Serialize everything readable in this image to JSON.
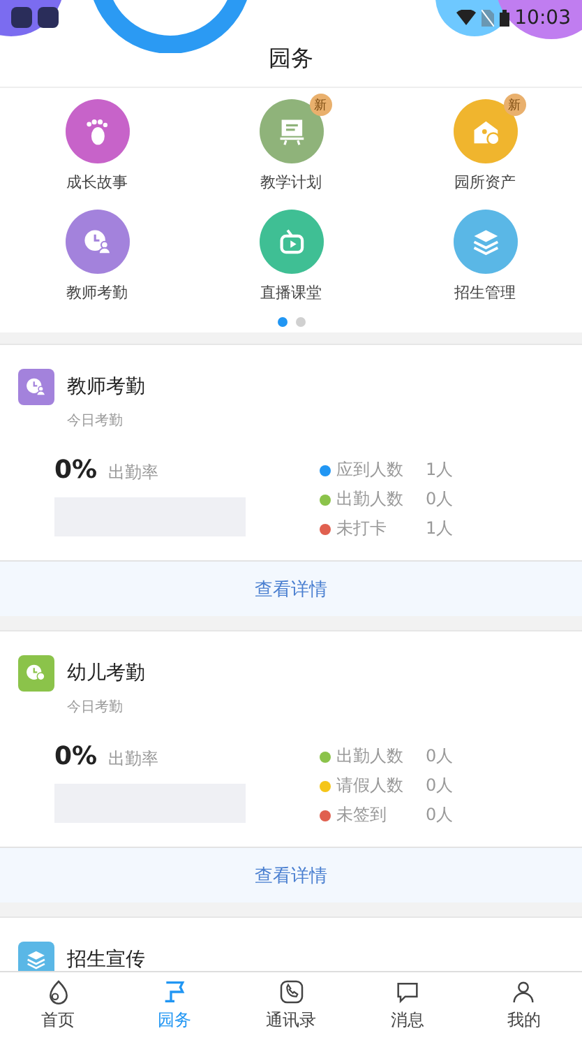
{
  "status_bar": {
    "time": "10:03"
  },
  "title": "园务",
  "menu": [
    {
      "label": "成长故事",
      "kind": "footprint",
      "color": "#c763c9"
    },
    {
      "label": "教学计划",
      "kind": "board",
      "color": "#8fb37a",
      "badge": "新"
    },
    {
      "label": "园所资产",
      "kind": "house",
      "color": "#f0b52e",
      "badge": "新"
    },
    {
      "label": "教师考勤",
      "kind": "clock",
      "color": "#a382dc"
    },
    {
      "label": "直播课堂",
      "kind": "tv",
      "color": "#3fbf94"
    },
    {
      "label": "招生管理",
      "kind": "layers",
      "color": "#5ab7e6"
    }
  ],
  "pager": [
    {
      "selected": true
    },
    {
      "selected": false
    }
  ],
  "cards": [
    {
      "title": "教师考勤",
      "subtitle": "今日考勤",
      "kind": "clock",
      "color": "#a382dc",
      "rate": "0%",
      "rate_label": "出勤率",
      "stats": [
        {
          "label": "应到人数",
          "value": "1人",
          "color": "#2196f3"
        },
        {
          "label": "出勤人数",
          "value": "0人",
          "color": "#8bc34a"
        },
        {
          "label": "未打卡",
          "value": "1人",
          "color": "#e0604f"
        }
      ],
      "action": "查看详情"
    },
    {
      "title": "幼儿考勤",
      "subtitle": "今日考勤",
      "kind": "child",
      "color": "#8bc34a",
      "rate": "0%",
      "rate_label": "出勤率",
      "stats": [
        {
          "label": "出勤人数",
          "value": "0人",
          "color": "#8bc34a"
        },
        {
          "label": "请假人数",
          "value": "0人",
          "color": "#f5c518"
        },
        {
          "label": "未签到",
          "value": "0人",
          "color": "#e0604f"
        }
      ],
      "action": "查看详情"
    },
    {
      "title": "招生宣传",
      "kind": "layers",
      "color": "#5ab7e6"
    }
  ],
  "tabs": [
    {
      "label": "首页",
      "kind": "home",
      "selected": false
    },
    {
      "label": "园务",
      "kind": "flag",
      "selected": true
    },
    {
      "label": "通讯录",
      "kind": "phone",
      "selected": false
    },
    {
      "label": "消息",
      "kind": "chat",
      "selected": false
    },
    {
      "label": "我的",
      "kind": "person",
      "selected": false
    }
  ]
}
